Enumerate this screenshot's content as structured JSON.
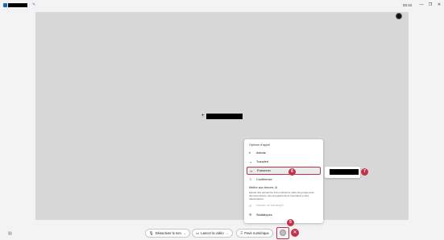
{
  "titlebar": {
    "timer": "00:42",
    "minimize_glyph": "—",
    "restore_glyph": "❐",
    "close_glyph": "✕",
    "pin_glyph": "✎"
  },
  "stage": {
    "cursor_glyph": "+"
  },
  "call_menu": {
    "heading": "Options d'appel",
    "items": [
      {
        "label": "Attente",
        "icon": "pause-icon",
        "glyph": "⏸"
      },
      {
        "label": "Transfert",
        "icon": "transfer-icon",
        "glyph": "⇢"
      },
      {
        "label": "Fusionner",
        "icon": "merge-icon",
        "glyph": "↣"
      },
      {
        "label": "Conférence",
        "icon": "conference-icon",
        "glyph": "☺"
      }
    ],
    "section_heading": "Mettre aux tenues",
    "section_ext_glyph": "⧉",
    "section_description": "Ajouter des personnes à la conférence vidéo de groupe avec des liens directs, des enregistrements importants et des transcriptions.",
    "disabled_item": {
      "label": "Lancer un transcript",
      "icon": "transcript-icon",
      "glyph": "Ꭿ"
    },
    "stats_item": {
      "label": "Statistiques",
      "icon": "stats-icon",
      "glyph": "⚙"
    }
  },
  "badges": {
    "fusionner": "6",
    "flyout": "7",
    "more_button": "5"
  },
  "controls": {
    "mute": {
      "label": "Désactiver le son",
      "glyph": "🎙",
      "chevron": "⌄"
    },
    "video": {
      "label": "Lancer la vidéo",
      "glyph": "▭",
      "chevron": "⌄"
    },
    "keypad": {
      "label": "Pavé numérique",
      "glyph": "⠿"
    },
    "hangup_glyph": "✕",
    "left_icon_glyph": "▤"
  },
  "colors": {
    "accent_red": "#c4314b",
    "brand_blue": "#0f6cbd"
  }
}
